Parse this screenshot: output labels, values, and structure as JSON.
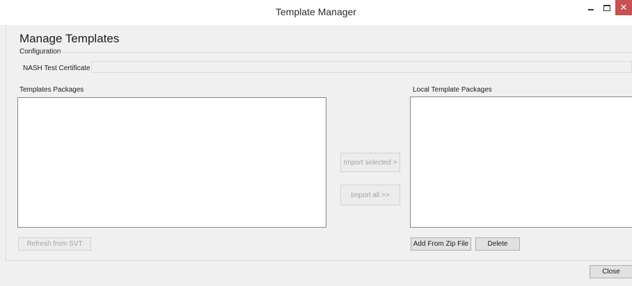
{
  "window": {
    "title": "Template Manager",
    "controls": {
      "minimize_icon": "minimize-icon",
      "maximize_icon": "maximize-icon",
      "close_glyph": "✕"
    },
    "close_color": "#c75050"
  },
  "main": {
    "heading": "Manage Templates",
    "configuration_group": "Configuration",
    "configuration_label": "NASH Test Certificate",
    "configuration_value": ""
  },
  "templates_packages": {
    "label": "Templates Packages",
    "items": []
  },
  "local_template_packages": {
    "label": "Local Template Packages",
    "items": []
  },
  "buttons": {
    "import_selected": "Import selected >",
    "import_all": "Import all >>",
    "refresh": "Refresh from SVT",
    "add_from_zip": "Add From Zip File",
    "delete": "Delete",
    "close": "Close"
  }
}
